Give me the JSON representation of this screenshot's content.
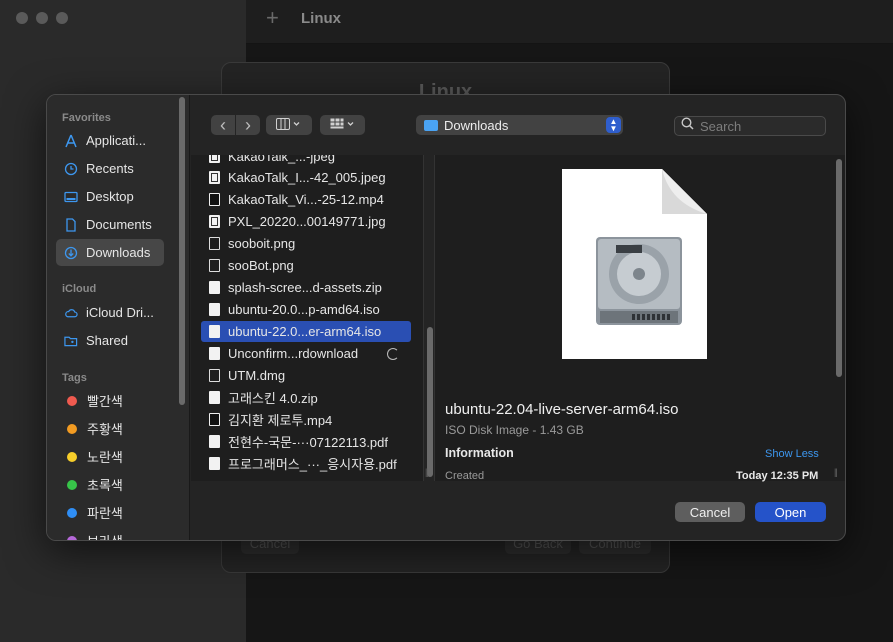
{
  "background": {
    "window_title": "Linux",
    "plus": "+",
    "sheet_title": "Linux",
    "buttons": [
      "Cancel",
      "Go Back",
      "Continue"
    ]
  },
  "toolbar": {
    "back": "‹",
    "forward": "›",
    "view_icon": "columns-view-icon",
    "group_icon": "grid-group-icon",
    "location": "Downloads",
    "search_placeholder": "Search"
  },
  "sidebar": {
    "favorites_header": "Favorites",
    "favorites": [
      {
        "label": "Applicati...",
        "icon": "applications-icon"
      },
      {
        "label": "Recents",
        "icon": "clock-icon"
      },
      {
        "label": "Desktop",
        "icon": "desktop-icon"
      },
      {
        "label": "Documents",
        "icon": "document-icon"
      },
      {
        "label": "Downloads",
        "icon": "download-icon",
        "selected": true
      }
    ],
    "icloud_header": "iCloud",
    "icloud": [
      {
        "label": "iCloud Dri...",
        "icon": "cloud-icon"
      },
      {
        "label": "Shared",
        "icon": "shared-folder-icon"
      }
    ],
    "tags_header": "Tags",
    "tags": [
      {
        "label": "빨간색",
        "color": "#ef5a4f"
      },
      {
        "label": "주황색",
        "color": "#f29b22"
      },
      {
        "label": "노란색",
        "color": "#f7ce2a"
      },
      {
        "label": "초록색",
        "color": "#37c449"
      },
      {
        "label": "파란색",
        "color": "#2f8ef5"
      },
      {
        "label": "보라색",
        "color": "#b568d8"
      }
    ]
  },
  "files": [
    {
      "name": "KakaoTalk_...-jpeg",
      "type": "image"
    },
    {
      "name": "KakaoTalk_I...-42_005.jpeg",
      "type": "image"
    },
    {
      "name": "KakaoTalk_Vi...-25-12.mp4",
      "type": "video"
    },
    {
      "name": "PXL_20220...00149771.jpg",
      "type": "image"
    },
    {
      "name": "sooboit.png",
      "type": "outline"
    },
    {
      "name": "sooBot.png",
      "type": "outline"
    },
    {
      "name": "splash-scree...d-assets.zip",
      "type": "doc"
    },
    {
      "name": "ubuntu-20.0...p-amd64.iso",
      "type": "doc"
    },
    {
      "name": "ubuntu-22.0...er-arm64.iso",
      "type": "doc",
      "selected": true
    },
    {
      "name": "Unconfirm...rdownload",
      "type": "doc",
      "downloading": true
    },
    {
      "name": "UTM.dmg",
      "type": "outline"
    },
    {
      "name": "고래스킨 4.0.zip",
      "type": "doc"
    },
    {
      "name": "김지환 제로투.mp4",
      "type": "video"
    },
    {
      "name": "전현수-국문-···07122113.pdf",
      "type": "doc"
    },
    {
      "name": "프로그래머스_···_응시자용.pdf",
      "type": "doc"
    }
  ],
  "preview": {
    "filename": "ubuntu-22.04-live-server-arm64.iso",
    "kind": "ISO Disk Image - 1.43 GB",
    "info_header": "Information",
    "show_less": "Show Less",
    "created_label": "Created",
    "created_value": "Today 12:35 PM"
  },
  "footer": {
    "cancel": "Cancel",
    "open": "Open"
  }
}
